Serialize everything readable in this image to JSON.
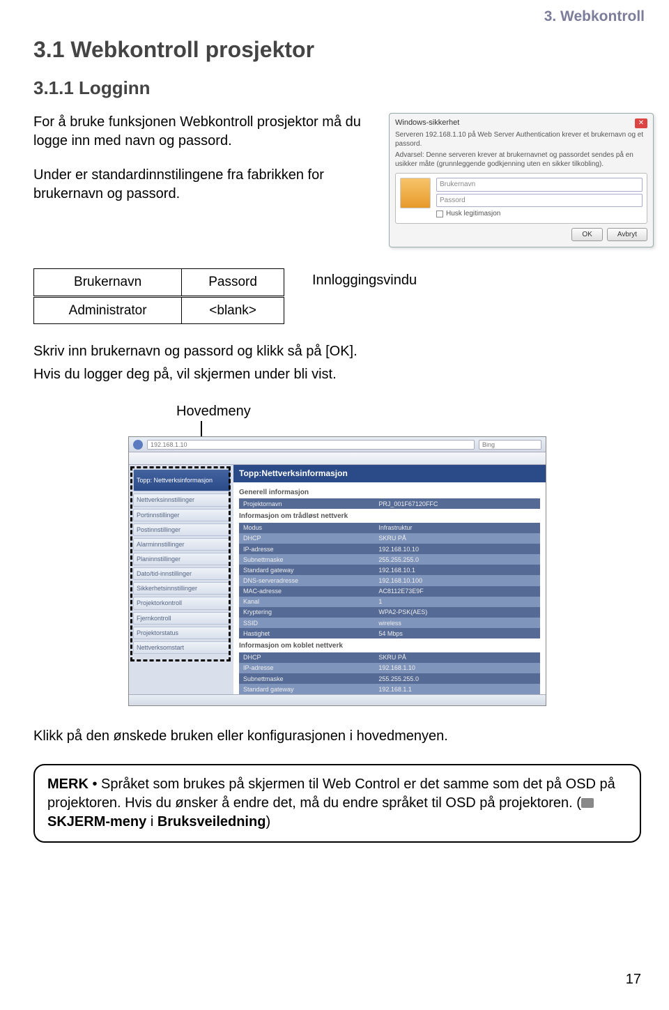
{
  "breadcrumb": "3. Webkontroll",
  "section_title": "3.1 Webkontroll prosjektor",
  "subsection_title": "3.1.1 Logginn",
  "intro_p1": "For å bruke funksjonen Webkontroll prosjektor må du logge inn med navn og passord.",
  "intro_p2": "Under er standardinnstilingene fra fabrikken for brukernavn og passord.",
  "login_dialog": {
    "title": "Windows-sikkerhet",
    "line1": "Serveren 192.168.1.10 på Web Server Authentication krever et brukernavn og et passord.",
    "line2": "Advarsel: Denne serveren krever at brukernavnet og passordet sendes på en usikker måte (grunnleggende godkjenning uten en sikker tilkobling).",
    "user_ph": "Brukernavn",
    "pass_ph": "Passord",
    "remember": "Husk legitimasjon",
    "ok": "OK",
    "cancel": "Avbryt"
  },
  "caption": "Innloggingsvindu",
  "creds_table": {
    "h1": "Brukernavn",
    "h2": "Passord",
    "r1c1": "Administrator",
    "r1c2": "<blank>"
  },
  "body_p1": "Skriv inn brukernavn og passord og klikk så på [OK].",
  "body_p2": "Hvis du logger deg på, vil skjermen under bli vist.",
  "hovedmeny_label": "Hovedmeny",
  "mainmenu": {
    "addr": "192.168.1.10",
    "search": "Bing",
    "banner": "Topp:Nettverksinformasjon",
    "side_first": "Topp: Nettverksinformasjon",
    "side_items": [
      "Nettverksinnstillinger",
      "Portinnstillinger",
      "Postinnstillinger",
      "Alarminnstillinger",
      "Planinnstillinger",
      "Dato/tid-innstillinger",
      "Sikkerhetsinnstillinger",
      "Projektorkontroll",
      "Fjernkontroll",
      "Projektorstatus",
      "Nettverksomstart"
    ],
    "sec1_title": "Generell informasjon",
    "sec1_rows": [
      [
        "Projektornavn",
        "PRJ_001F67120FFC"
      ]
    ],
    "sec2_title": "Informasjon om trådløst nettverk",
    "sec2_rows": [
      [
        "Modus",
        "Infrastruktur"
      ],
      [
        "DHCP",
        "SKRU PÅ"
      ],
      [
        "IP-adresse",
        "192.168.10.10"
      ],
      [
        "Subnettmaske",
        "255.255.255.0"
      ],
      [
        "Standard gateway",
        "192.168.10.1"
      ],
      [
        "DNS-serveradresse",
        "192.168.10.100"
      ],
      [
        "MAC-adresse",
        "AC8112E73E9F"
      ],
      [
        "Kanal",
        "1"
      ],
      [
        "Kryptering",
        "WPA2-PSK(AES)"
      ],
      [
        "SSID",
        "wireless"
      ],
      [
        "Hastighet",
        "54 Mbps"
      ]
    ],
    "sec3_title": "Informasjon om koblet nettverk",
    "sec3_rows": [
      [
        "DHCP",
        "SKRU PÅ"
      ],
      [
        "IP-adresse",
        "192.168.1.10"
      ],
      [
        "Subnettmaske",
        "255.255.255.0"
      ],
      [
        "Standard gateway",
        "192.168.1.1"
      ]
    ]
  },
  "post_p": "Klikk på den ønskede bruken eller konfigurasjonen i hovedmenyen.",
  "note": {
    "lead": "MERK",
    "text1": " • Språket som brukes på skjermen til Web Control er det samme som det på OSD på projektoren. Hvis du ønsker å endre det, må du endre språket til OSD på projektoren. (",
    "ref": "SKJERM-meny",
    "text2": " i ",
    "ref2": "Bruksveiledning",
    "text3": ")"
  },
  "page_number": "17"
}
